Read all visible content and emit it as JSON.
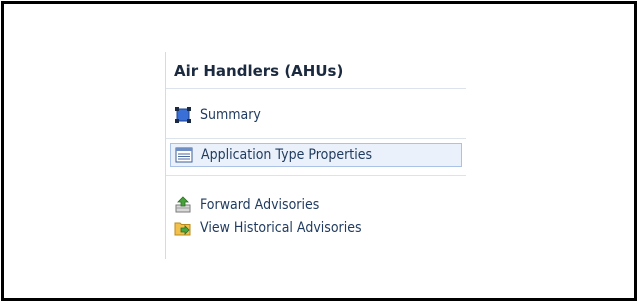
{
  "panel": {
    "title": "Air Handlers (AHUs)",
    "items": [
      {
        "label": "Summary",
        "icon": "summary-square-icon"
      },
      {
        "label": "Application Type Properties",
        "icon": "properties-list-icon",
        "selected": true
      },
      {
        "label": "Forward Advisories",
        "icon": "forward-advisories-icon"
      },
      {
        "label": "View Historical Advisories",
        "icon": "historical-advisories-icon"
      }
    ]
  },
  "colors": {
    "border": "#000000",
    "selection_bg": "#eaf1fb",
    "selection_border": "#a9c2e6",
    "text": "#1f3a5e"
  }
}
